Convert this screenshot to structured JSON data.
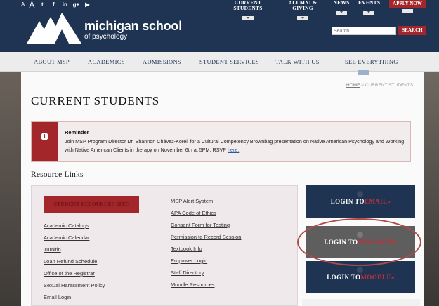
{
  "util": {
    "font_small": "A",
    "font_big": "A",
    "social": [
      "twitter-icon",
      "facebook-icon",
      "linkedin-icon",
      "googleplus-icon",
      "youtube-icon"
    ],
    "social_glyphs": [
      "t",
      "f",
      "in",
      "g+",
      "▶"
    ]
  },
  "topnav": {
    "current_students": "CURRENT STUDENTS",
    "alumni_giving": "ALUMNI & GIVING",
    "news": "NEWS",
    "events": "EVENTS",
    "apply_now": "APPLY NOW"
  },
  "logo": {
    "line1": "michigan school",
    "line2": "of psychology"
  },
  "search": {
    "placeholder": "Search...",
    "button": "SEARCH"
  },
  "mainnav": [
    "ABOUT MSP",
    "ACADEMICS",
    "ADMISSIONS",
    "STUDENT SERVICES",
    "TALK WITH US",
    "SEE EVERYTHING"
  ],
  "breadcrumb": {
    "home": "HOME",
    "sep": " // ",
    "current": "CURRENT STUDENTS"
  },
  "page_title": "CURRENT STUDENTS",
  "reminder": {
    "icon": "i",
    "title": "Reminder",
    "body": "Join MSP Program Director Dr. Shannon Chávez-Korell for a Cultural Competency Brownbag presentation on Native American Psychology and Working with Native American Clients in therapy on November 6th at 5PM. RSVP ",
    "link": "here."
  },
  "resource_title": "Resource Links",
  "student_resources_button": "STUDENT RESOURCES SITE",
  "links_left": [
    "Academic Catalogs",
    "Academic Calendar",
    "Turnitin",
    "Loan Refund Schedule",
    "Office of the Registrar",
    "Sexual Harassment Policy",
    "Email Login"
  ],
  "links_right": [
    "MSP Alert System",
    "APA Code of Ethics",
    "Consent Form for Testing",
    "Permission to Record Session",
    "Textbook Info",
    "Empower Login",
    "Staff Directory",
    "Moodle Resources"
  ],
  "logins": [
    {
      "prefix": "LOGIN TO ",
      "name": "EMAIL",
      "suffix": " »"
    },
    {
      "prefix": "LOGIN TO ",
      "name": "EMPOWER",
      "suffix": " »"
    },
    {
      "prefix": "LOGIN TO ",
      "name": "MOODLE",
      "suffix": " »"
    }
  ],
  "colors": {
    "navy": "#1f3352",
    "crimson": "#a3262b",
    "highlight_circle": "#b04a48"
  }
}
